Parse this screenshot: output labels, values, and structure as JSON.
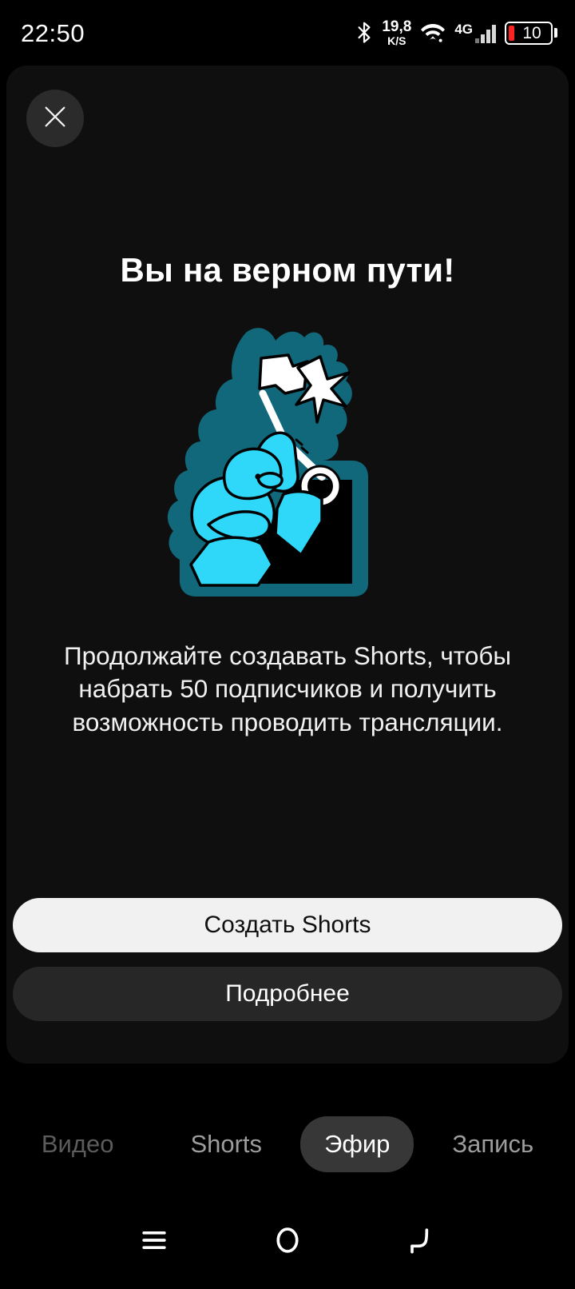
{
  "status_bar": {
    "time": "22:50",
    "bluetooth_icon": "bluetooth-icon",
    "net_speed_value": "19,8",
    "net_speed_unit": "K/S",
    "wifi_icon": "wifi-icon",
    "network_type": "4G",
    "signal_icon": "signal-bars-icon",
    "battery_level": "10",
    "battery_color": "#ff2222"
  },
  "sheet": {
    "close_label": "close-icon",
    "title": "Вы на верном пути!",
    "illustration_name": "climber-with-flag-and-key-illustration",
    "illustration_colors": {
      "cyan": "#2fd8f8",
      "teal": "#10687a",
      "white": "#ffffff",
      "black": "#000000"
    },
    "body_text": "Продолжайте создавать Shorts, чтобы набрать 50 подписчиков и получить возможность проводить трансляции.",
    "primary_button": "Создать Shorts",
    "secondary_button": "Подробнее"
  },
  "tabs": [
    {
      "label": "Видео",
      "selected": false
    },
    {
      "label": "Shorts",
      "selected": false
    },
    {
      "label": "Эфир",
      "selected": true
    },
    {
      "label": "Запись",
      "selected": false
    }
  ],
  "nav_bar": {
    "recents_icon": "menu-icon",
    "home_icon": "home-circle-icon",
    "back_icon": "back-arrow-icon"
  }
}
